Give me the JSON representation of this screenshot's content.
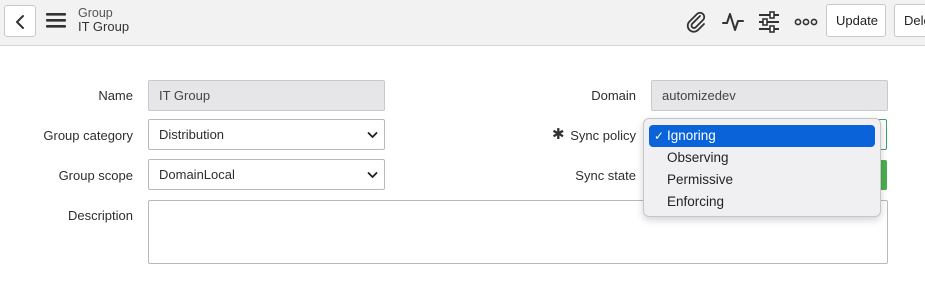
{
  "header": {
    "record_type": "Group",
    "record_name": "IT Group",
    "buttons": {
      "update": "Update",
      "delete": "Delete"
    }
  },
  "form": {
    "name": {
      "label": "Name",
      "value": "IT Group"
    },
    "group_category": {
      "label": "Group category",
      "value": "Distribution"
    },
    "group_scope": {
      "label": "Group scope",
      "value": "DomainLocal"
    },
    "description": {
      "label": "Description",
      "value": ""
    },
    "domain": {
      "label": "Domain",
      "value": "automizedev"
    },
    "sync_policy": {
      "label": "Sync policy",
      "required_marker": "✱",
      "options": [
        "Ignoring",
        "Observing",
        "Permissive",
        "Enforcing"
      ],
      "selected": "Ignoring"
    },
    "sync_state": {
      "label": "Sync state"
    }
  },
  "colors": {
    "accent": "#0a63d8",
    "status_green": "#4caf50",
    "header_bg": "#f2f2f3"
  },
  "icons": [
    "chevron-left-icon",
    "hamburger-menu-icon",
    "paperclip-icon",
    "activity-icon",
    "sliders-icon",
    "more-icon"
  ]
}
